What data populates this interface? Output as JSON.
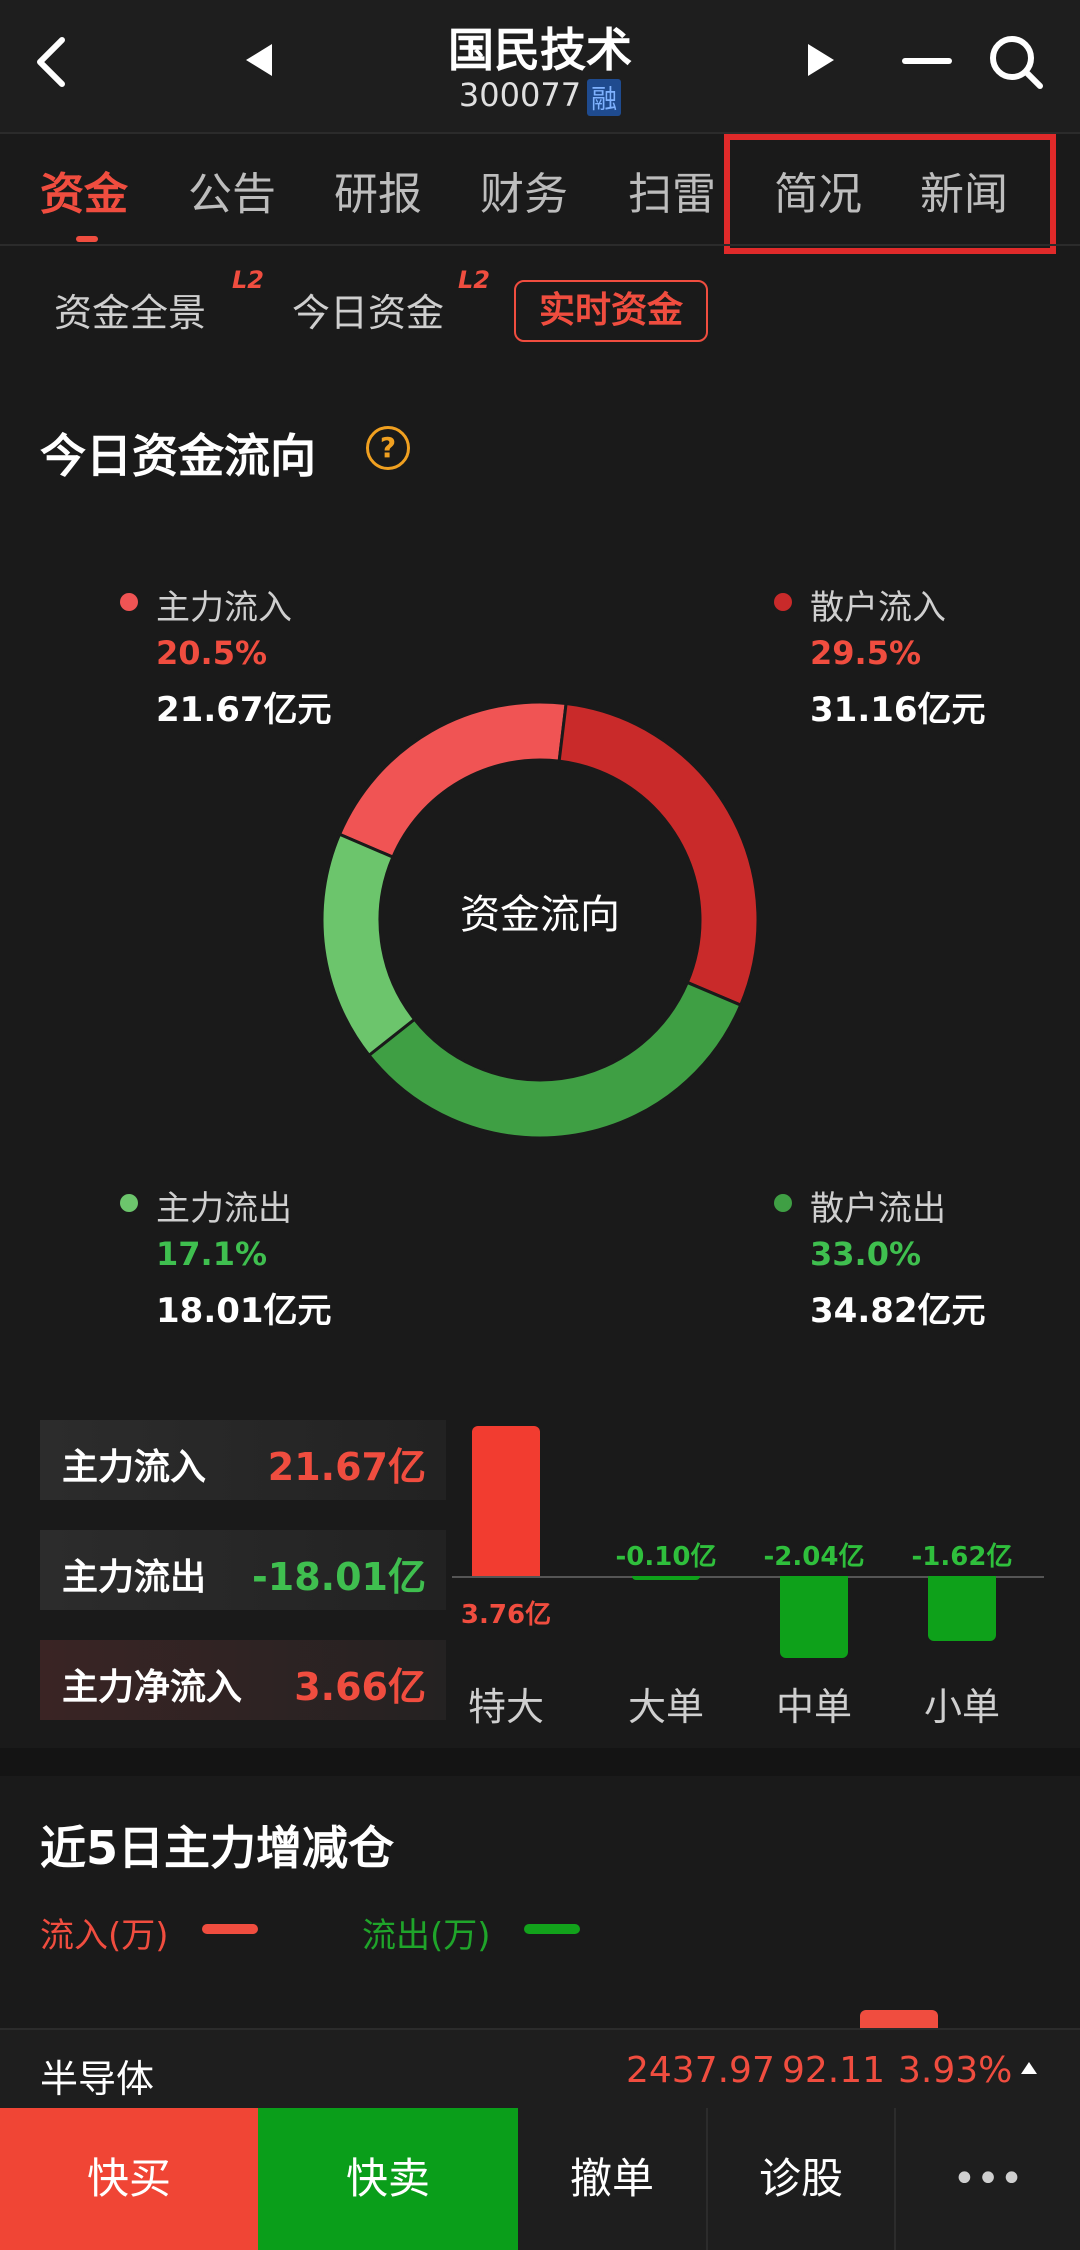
{
  "header": {
    "title": "国民技术",
    "code": "300077",
    "badge": "融",
    "icons": [
      "back-icon",
      "prev-stock-icon",
      "next-stock-icon",
      "menu-icon",
      "search-icon"
    ]
  },
  "tabs": [
    {
      "label": "资金",
      "active": true
    },
    {
      "label": "公告"
    },
    {
      "label": "研报"
    },
    {
      "label": "财务"
    },
    {
      "label": "扫雷"
    },
    {
      "label": "简况"
    },
    {
      "label": "新闻"
    }
  ],
  "subtabs": [
    {
      "label": "资金全景",
      "badge": "L2"
    },
    {
      "label": "今日资金",
      "badge": "L2"
    },
    {
      "label": "实时资金",
      "active": true
    }
  ],
  "today_flow": {
    "title": "今日资金流向",
    "donut_center": "资金流向",
    "legend": {
      "main_in": {
        "label": "主力流入",
        "pct": "20.5%",
        "amount": "21.67亿元",
        "color": "#f05454"
      },
      "retail_in": {
        "label": "散户流入",
        "pct": "29.5%",
        "amount": "31.16亿元",
        "color": "#c92a2a"
      },
      "main_out": {
        "label": "主力流出",
        "pct": "17.1%",
        "amount": "18.01亿元",
        "color": "#6cc56c"
      },
      "retail_out": {
        "label": "散户流出",
        "pct": "33.0%",
        "amount": "34.82亿元",
        "color": "#3f9f44"
      }
    }
  },
  "chart_data": {
    "type": "pie",
    "title": "资金流向",
    "slices": [
      {
        "name": "主力流入",
        "value": 20.5,
        "color": "#f05454"
      },
      {
        "name": "散户流入",
        "value": 29.5,
        "color": "#c92a2a"
      },
      {
        "name": "散户流出",
        "value": 33.0,
        "color": "#3f9f44"
      },
      {
        "name": "主力流出",
        "value": 17.1,
        "color": "#6cc56c"
      }
    ]
  },
  "summary_rows": [
    {
      "label": "主力流入",
      "value": "21.67亿",
      "tone": "red"
    },
    {
      "label": "主力流出",
      "value": "-18.01亿",
      "tone": "green"
    },
    {
      "label": "主力净流入",
      "value": "3.66亿",
      "tone": "red"
    }
  ],
  "order_bars": {
    "type": "bar",
    "categories": [
      "特大",
      "大单",
      "中单",
      "小单"
    ],
    "values": [
      3.76,
      -0.1,
      -2.04,
      -1.62
    ],
    "labels": [
      "3.76亿",
      "-0.10亿",
      "-2.04亿",
      "-1.62亿"
    ]
  },
  "five_day": {
    "title": "近5日主力增减仓",
    "legend_in": "流入(万)",
    "legend_out": "流出(万)"
  },
  "ticker": {
    "name": "半导体",
    "price": "2437.97",
    "change": "92.11",
    "pct": "3.93%"
  },
  "bottom": {
    "buy": "快买",
    "sell": "快卖",
    "cancel": "撤单",
    "diagnose": "诊股",
    "more": "•••"
  }
}
